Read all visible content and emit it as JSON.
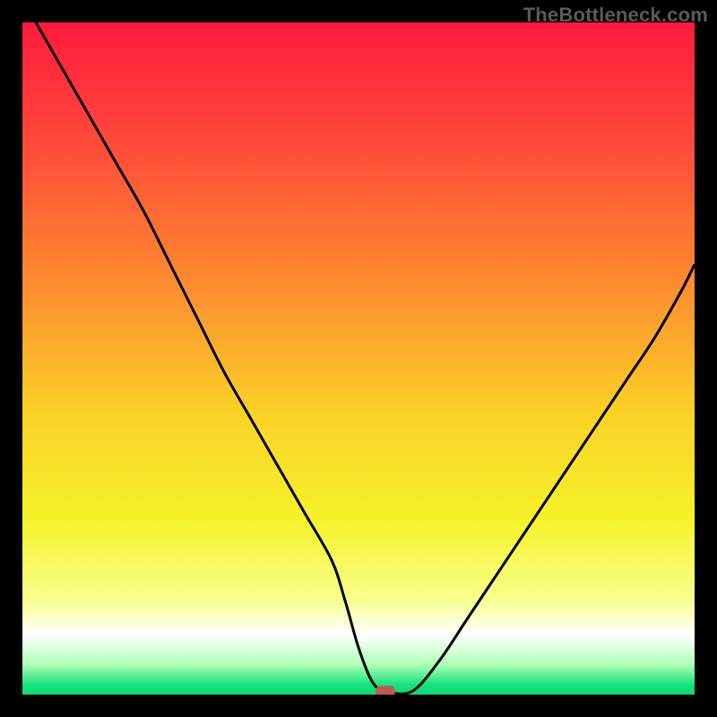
{
  "watermark": "TheBottleneck.com",
  "chart_data": {
    "type": "line",
    "title": "",
    "xlabel": "",
    "ylabel": "",
    "xlim": [
      0,
      100
    ],
    "ylim": [
      0,
      100
    ],
    "gradient_stops": [
      {
        "offset": 0.0,
        "color": "#ff1a3d"
      },
      {
        "offset": 0.18,
        "color": "#ff4a3a"
      },
      {
        "offset": 0.4,
        "color": "#fd8f2f"
      },
      {
        "offset": 0.58,
        "color": "#fbd127"
      },
      {
        "offset": 0.74,
        "color": "#f6f22a"
      },
      {
        "offset": 0.86,
        "color": "#f8ff8e"
      },
      {
        "offset": 0.91,
        "color": "#ffffff"
      },
      {
        "offset": 0.955,
        "color": "#b0ffb6"
      },
      {
        "offset": 0.985,
        "color": "#18e27e"
      },
      {
        "offset": 1.0,
        "color": "#0fd878"
      }
    ],
    "series": [
      {
        "name": "bottleneck-curve",
        "x": [
          2,
          6,
          10,
          14,
          18,
          22,
          26,
          30,
          34,
          38,
          42,
          46,
          48,
          50,
          52,
          54,
          58,
          62,
          66,
          70,
          74,
          78,
          82,
          86,
          90,
          94,
          98,
          100
        ],
        "y": [
          100,
          93,
          86,
          79,
          72,
          64,
          56,
          48,
          41,
          34,
          27,
          20,
          14,
          7,
          2,
          0.5,
          0.5,
          5,
          11,
          17,
          23,
          29,
          35,
          41,
          47,
          53,
          60,
          64
        ]
      }
    ],
    "annotations": [
      {
        "name": "min-marker",
        "x": 54,
        "y": 0.5,
        "shape": "rounded-rect",
        "color": "#c05a55"
      }
    ],
    "legend": []
  }
}
